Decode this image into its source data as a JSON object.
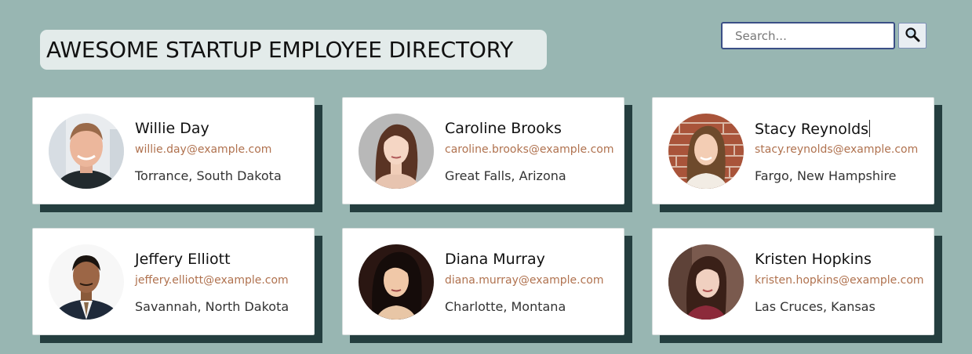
{
  "header": {
    "title": "AWESOME STARTUP EMPLOYEE DIRECTORY"
  },
  "search": {
    "placeholder": "Search...",
    "value": "",
    "button_icon": "search-icon"
  },
  "employees": [
    {
      "name": "Willie Day",
      "email": "willie.day@example.com",
      "location": "Torrance, South Dakota"
    },
    {
      "name": "Caroline Brooks",
      "email": "caroline.brooks@example.com",
      "location": "Great Falls, Arizona"
    },
    {
      "name": "Stacy Reynolds",
      "email": "stacy.reynolds@example.com",
      "location": "Fargo, New Hampshire"
    },
    {
      "name": "Jeffery Elliott",
      "email": "jeffery.elliott@example.com",
      "location": "Savannah, North Dakota"
    },
    {
      "name": "Diana Murray",
      "email": "diana.murray@example.com",
      "location": "Charlotte, Montana"
    },
    {
      "name": "Kristen Hopkins",
      "email": "kristen.hopkins@example.com",
      "location": "Las Cruces, Kansas"
    }
  ],
  "colors": {
    "background": "#98b6b2",
    "card_shadow": "#243e3f",
    "email_text": "#b0724f",
    "title_box": "#e3ebea",
    "search_border": "#3b4f86"
  }
}
